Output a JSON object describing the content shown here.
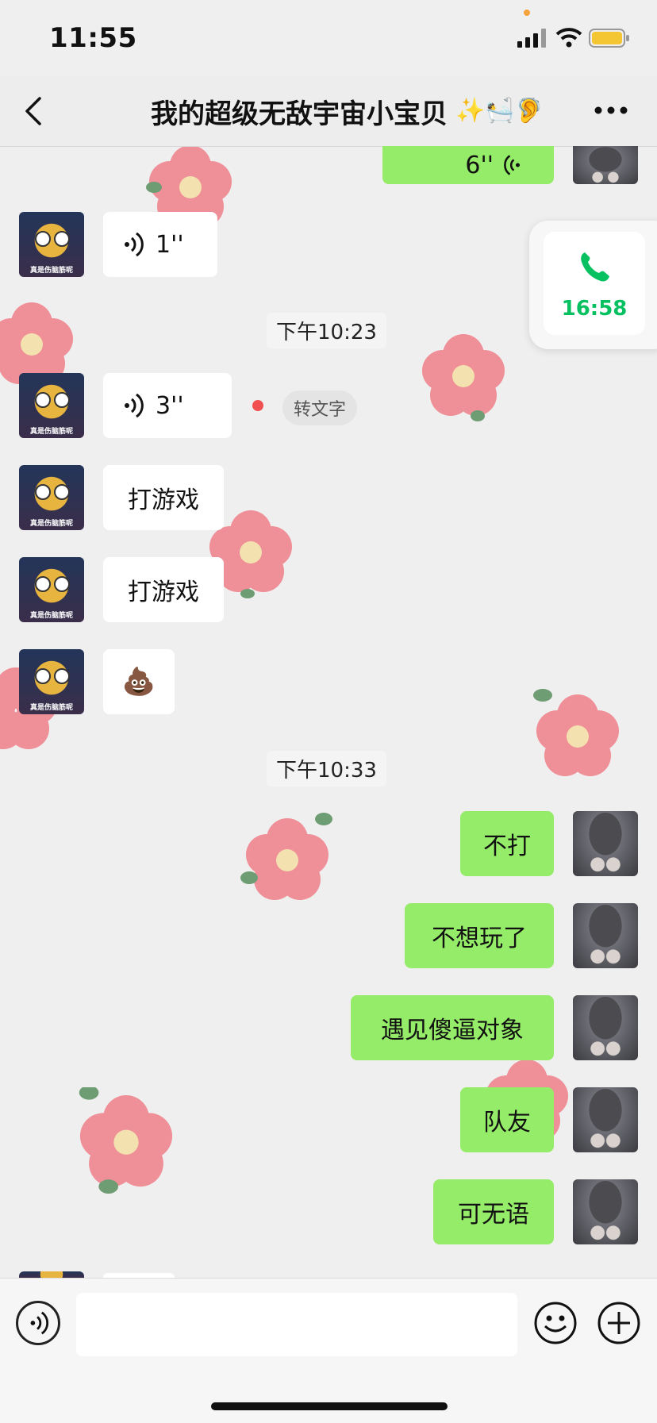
{
  "status": {
    "time": "11:55"
  },
  "nav": {
    "title": "我的超级无敌宇宙小宝贝",
    "title_emojis": "✨🛀🦻"
  },
  "call": {
    "duration": "16:58"
  },
  "avatars": {
    "her_caption": "真是伤脑筋呢"
  },
  "messages": {
    "m1_voice": "6''",
    "m2_voice": "1''",
    "t1": "下午10:23",
    "m3_voice": "3''",
    "m3_convert": "转文字",
    "m4": "打游戏",
    "m5": "打游戏",
    "m6": "💩",
    "t2": "下午10:33",
    "m7": "不打",
    "m8": "不想玩了",
    "m9": "遇见傻逼对象",
    "m10": "队友",
    "m11": "可无语"
  },
  "input": {
    "value": "",
    "placeholder": ""
  },
  "colors": {
    "bubble_green": "#95ec69",
    "call_green": "#07c160",
    "bg": "#efefef"
  }
}
